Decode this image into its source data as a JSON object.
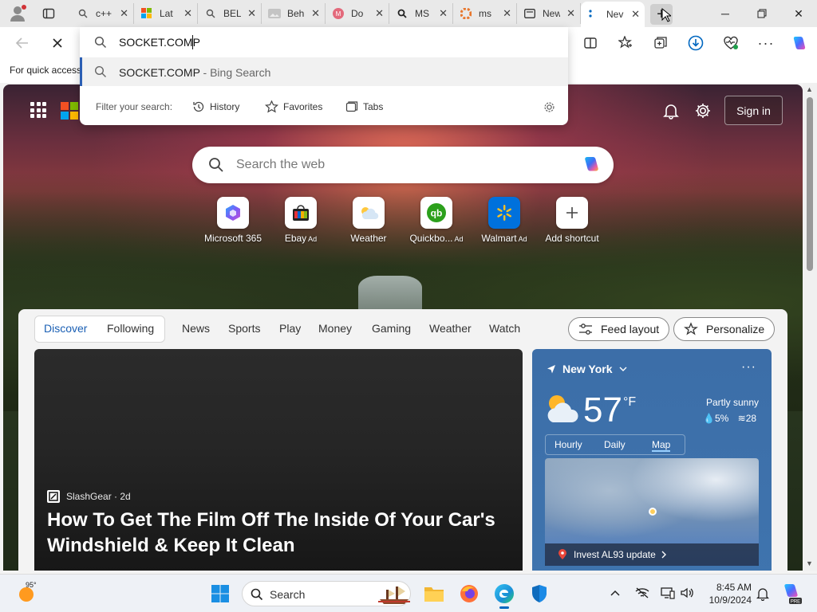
{
  "tabs": [
    {
      "title": "c++",
      "favicon": "search-icon"
    },
    {
      "title": "Lat",
      "favicon": "windows-logo"
    },
    {
      "title": "BEL",
      "favicon": "search-icon"
    },
    {
      "title": "Beh",
      "favicon": "image-icon"
    },
    {
      "title": "Do",
      "favicon": "app-icon"
    },
    {
      "title": "MS",
      "favicon": "search-icon"
    },
    {
      "title": "ms",
      "favicon": "app-icon"
    },
    {
      "title": "New",
      "favicon": "tab-icon"
    },
    {
      "title": "Nev",
      "favicon": "loading-icon"
    }
  ],
  "omnibox": {
    "value": "SOCKET.COMP",
    "suggestion_text": "SOCKET.COMP",
    "suggestion_suffix": " - Bing Search",
    "filter_label": "Filter your search:",
    "filters": [
      "History",
      "Favorites",
      "Tabs"
    ]
  },
  "favorites_bar": {
    "text": "For quick access"
  },
  "ntp": {
    "sign_in": "Sign in",
    "search_placeholder": "Search the web",
    "shortcuts": [
      {
        "label": "Microsoft 365",
        "ad": ""
      },
      {
        "label": "Ebay",
        "ad": "Ad"
      },
      {
        "label": "Weather",
        "ad": ""
      },
      {
        "label": "Quickbo...",
        "ad": "Ad"
      },
      {
        "label": "Walmart",
        "ad": "Ad"
      },
      {
        "label": "Add shortcut",
        "ad": ""
      }
    ],
    "feed_tabs": [
      "Discover",
      "Following"
    ],
    "feed_nav": [
      "News",
      "Sports",
      "Play",
      "Money",
      "Gaming",
      "Weather",
      "Watch"
    ],
    "feed_layout": "Feed layout",
    "personalize": "Personalize",
    "hero": {
      "source": "SlashGear · 2d",
      "headline": "How To Get The Film Off The Inside Of Your Car's Windshield & Keep It Clean"
    },
    "weather": {
      "location": "New York",
      "temp": "57",
      "unit": "°F",
      "condition": "Partly sunny",
      "precip": "5%",
      "wind": "28",
      "tabs": [
        "Hourly",
        "Daily",
        "Map"
      ],
      "alert": "Invest AL93 update"
    }
  },
  "taskbar": {
    "weather_temp": "95°",
    "search_label": "Search",
    "time": "8:45 AM",
    "date": "10/9/2024"
  },
  "colors": {
    "accent": "#0067c0",
    "omnibox_highlight": "#2b5fb4",
    "weather_card": "#3c6ea8"
  }
}
